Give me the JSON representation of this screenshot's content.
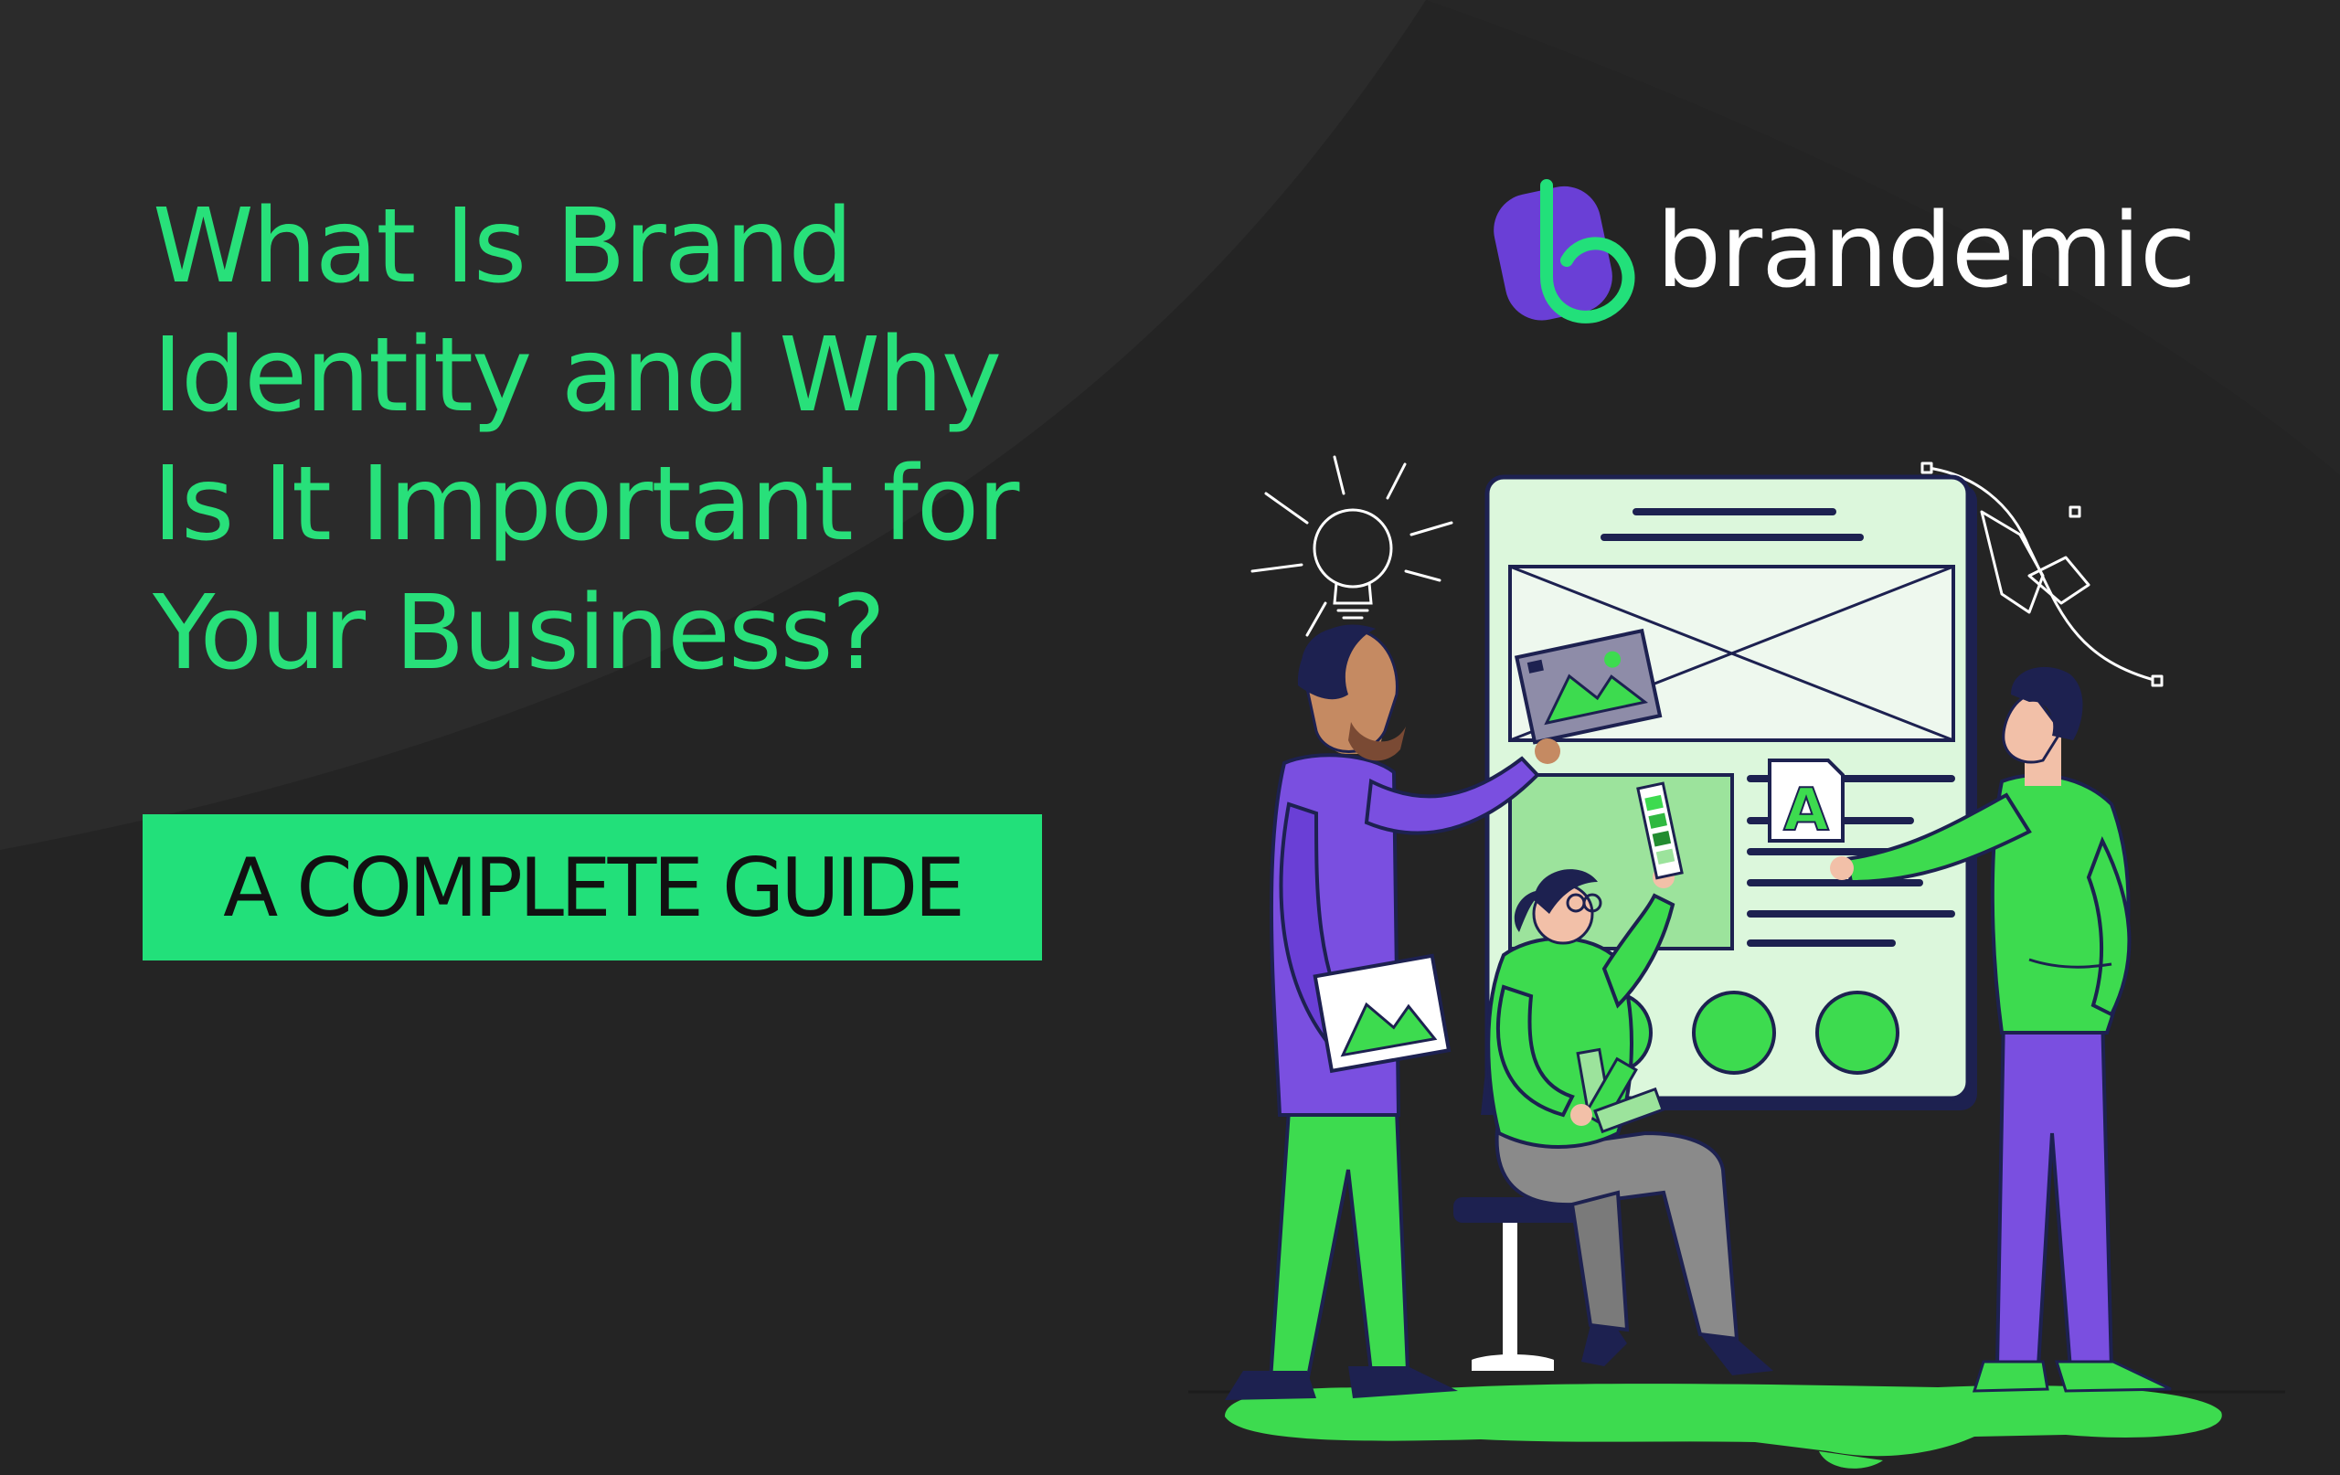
{
  "headline": {
    "lines": [
      "What Is Brand",
      "Identity and Why",
      "Is It Important for",
      "Your Business?"
    ]
  },
  "badge": {
    "label": "A COMPLETE GUIDE"
  },
  "brand": {
    "name": "brandemic"
  },
  "illustration": {
    "poster_letter": "A",
    "people": [
      "bearded-man",
      "seated-woman",
      "standing-man"
    ]
  },
  "colors": {
    "background": "#242424",
    "accent_green": "#22e07a",
    "purple": "#7a4fe0",
    "navy": "#1d2150",
    "text_white": "#ffffff"
  }
}
